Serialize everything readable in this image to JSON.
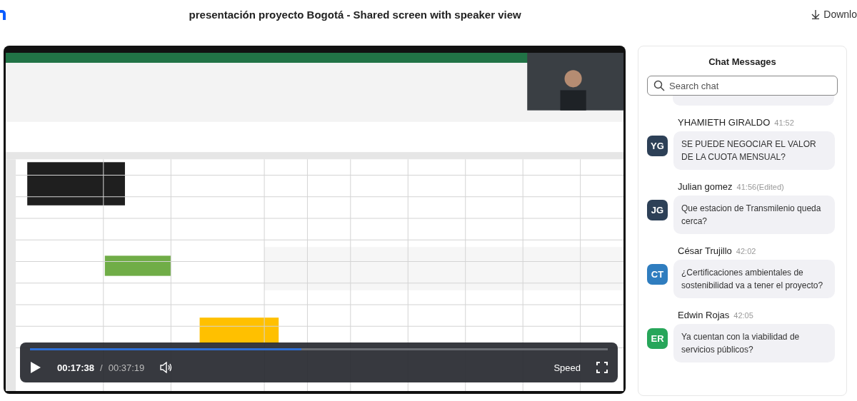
{
  "header": {
    "title": "presentación proyecto Bogotá - Shared screen with speaker view",
    "download_label": "Downlo"
  },
  "player": {
    "kind": "picture",
    "progress": {
      "level": 0.47
    },
    "current_time": "00:17:38",
    "separator": "/",
    "duration": "00:37:19",
    "speed_label": "Speed"
  },
  "chat": {
    "title": "Chat Messages",
    "search": {
      "placeholder": "Search chat"
    },
    "messages": [
      {
        "initials": "YG",
        "color": "#2d4057",
        "name": "YHAMIETH GIRALDO",
        "time": "41:52",
        "text": "SE PUEDE NEGOCIAR EL VALOR DE LA CUOTA MENSUAL?"
      },
      {
        "initials": "JG",
        "color": "#2d4057",
        "name": "Julian gomez",
        "time": "41:56",
        "edited": "(Edited)",
        "text": "Que estacion de Transmilenio queda cerca?"
      },
      {
        "initials": "CT",
        "color": "#2f7dbf",
        "name": "César Trujillo",
        "time": "42:02",
        "text": "¿Certificaciones ambientales de sostenibilidad va a tener el proyecto?"
      },
      {
        "initials": "ER",
        "color": "#27a65a",
        "name": "Edwin Rojas",
        "time": "42:05",
        "text": "Ya cuentan con la viabilidad de servicios públicos?"
      }
    ]
  }
}
